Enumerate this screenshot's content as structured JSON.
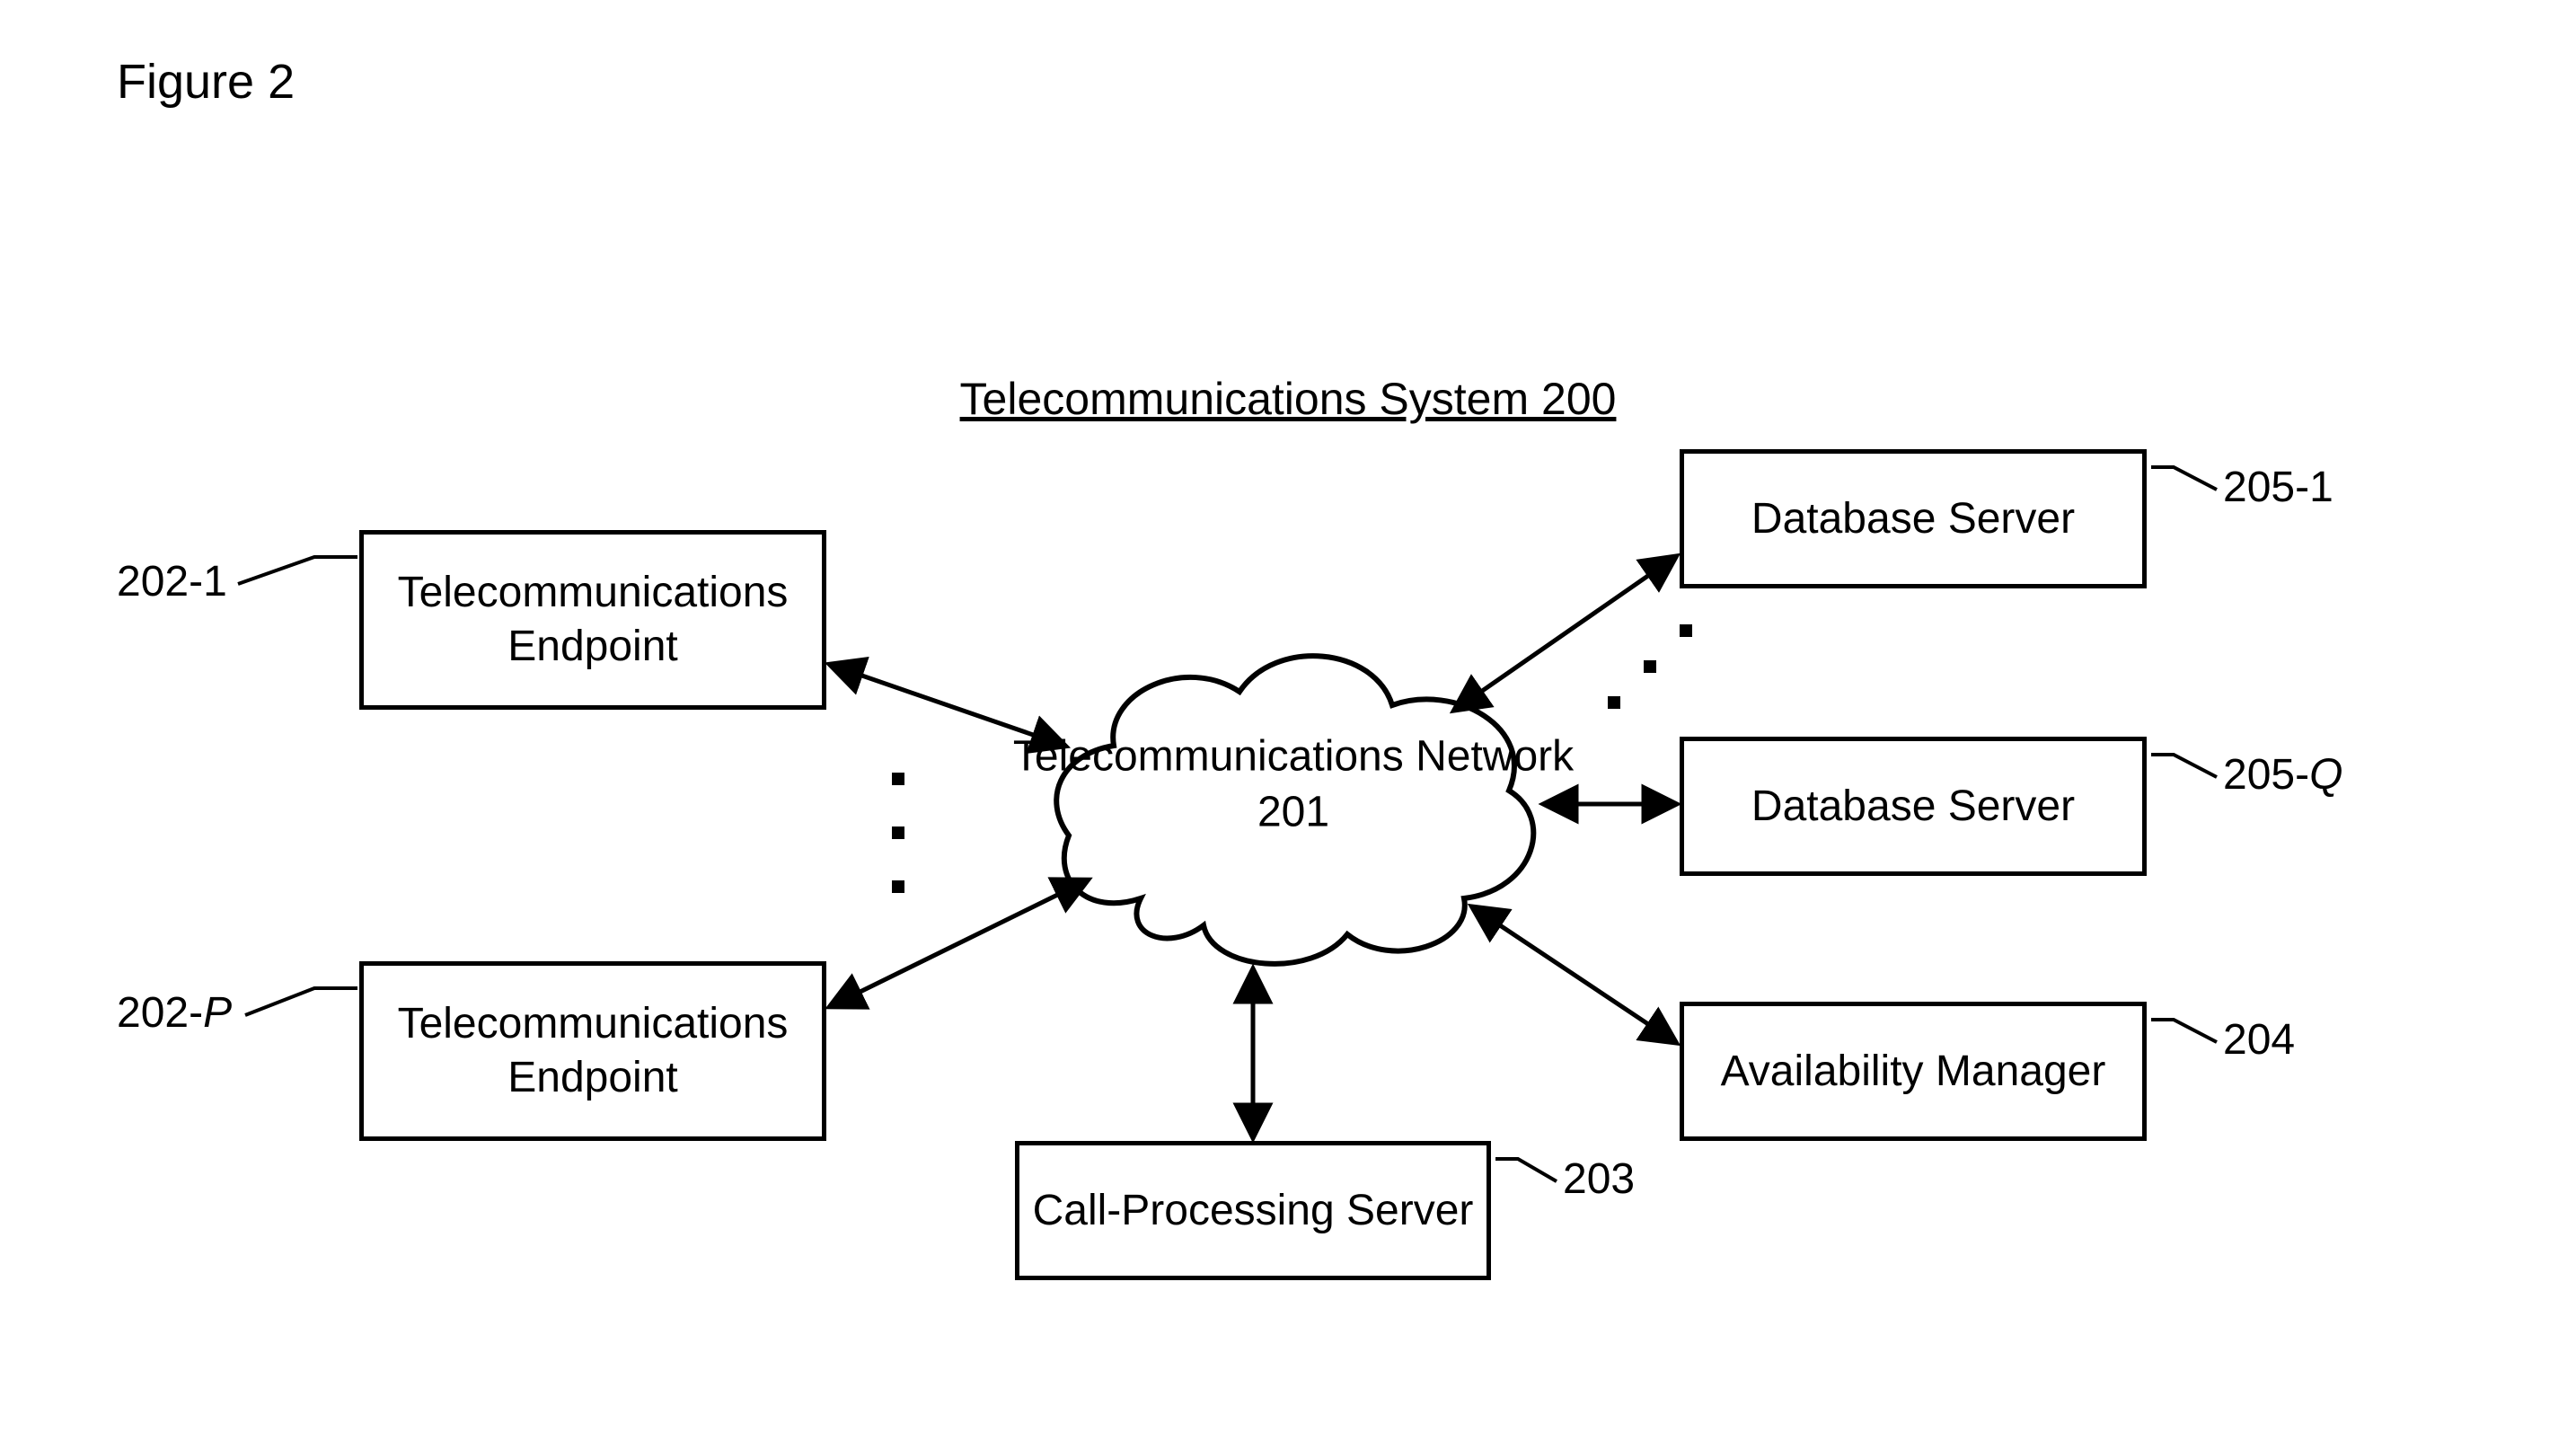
{
  "figure_label": "Figure 2",
  "title": "Telecommunications System 200",
  "nodes": {
    "endpoint1": {
      "label": "Telecommunications\nEndpoint",
      "ref": "202-1"
    },
    "endpointP": {
      "label": "Telecommunications\nEndpoint",
      "ref": "202-P",
      "ref_italic_tail": "P"
    },
    "network": {
      "label": "Telecommunications Network\n201",
      "ref": "201"
    },
    "cps": {
      "label": "Call-Processing Server",
      "ref": "203"
    },
    "avail": {
      "label": "Availability Manager",
      "ref": "204"
    },
    "db1": {
      "label": "Database Server",
      "ref": "205-1"
    },
    "dbQ": {
      "label": "Database Server",
      "ref": "205-Q",
      "ref_italic_tail": "Q"
    }
  }
}
